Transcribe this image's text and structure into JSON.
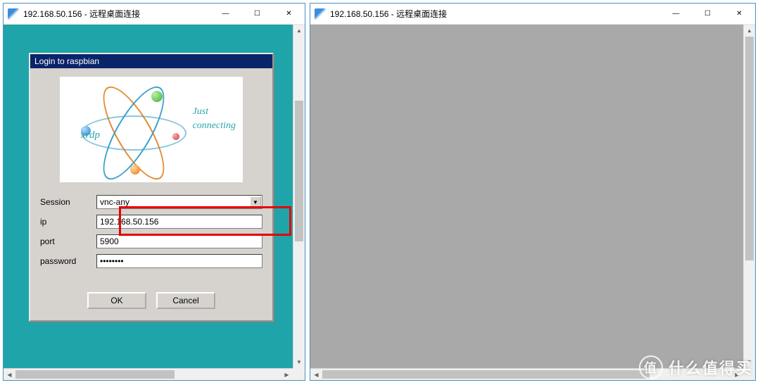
{
  "windows": {
    "left": {
      "title": "192.168.50.156 - 远程桌面连接",
      "titlebar": {
        "minimize": "—",
        "maximize": "☐",
        "close": "✕"
      }
    },
    "right": {
      "title": "192.168.50.156 - 远程桌面连接",
      "titlebar": {
        "minimize": "—",
        "maximize": "☐",
        "close": "✕"
      }
    }
  },
  "login_dialog": {
    "title": "Login to raspbian",
    "logo": {
      "product": "xrdp",
      "tagline_line1": "Just",
      "tagline_line2": "connecting"
    },
    "fields": {
      "session_label": "Session",
      "session_value": "vnc-any",
      "ip_label": "ip",
      "ip_value": "192.168.50.156",
      "port_label": "port",
      "port_value": "5900",
      "password_label": "password",
      "password_value": "••••••••"
    },
    "buttons": {
      "ok": "OK",
      "cancel": "Cancel"
    }
  },
  "watermark": {
    "logo": "值",
    "text": "什么值得买"
  },
  "colors": {
    "teal": "#1fa5a9",
    "gray": "#a9a9a9",
    "highlight": "#e60000",
    "dialog_title": "#0a246a"
  }
}
